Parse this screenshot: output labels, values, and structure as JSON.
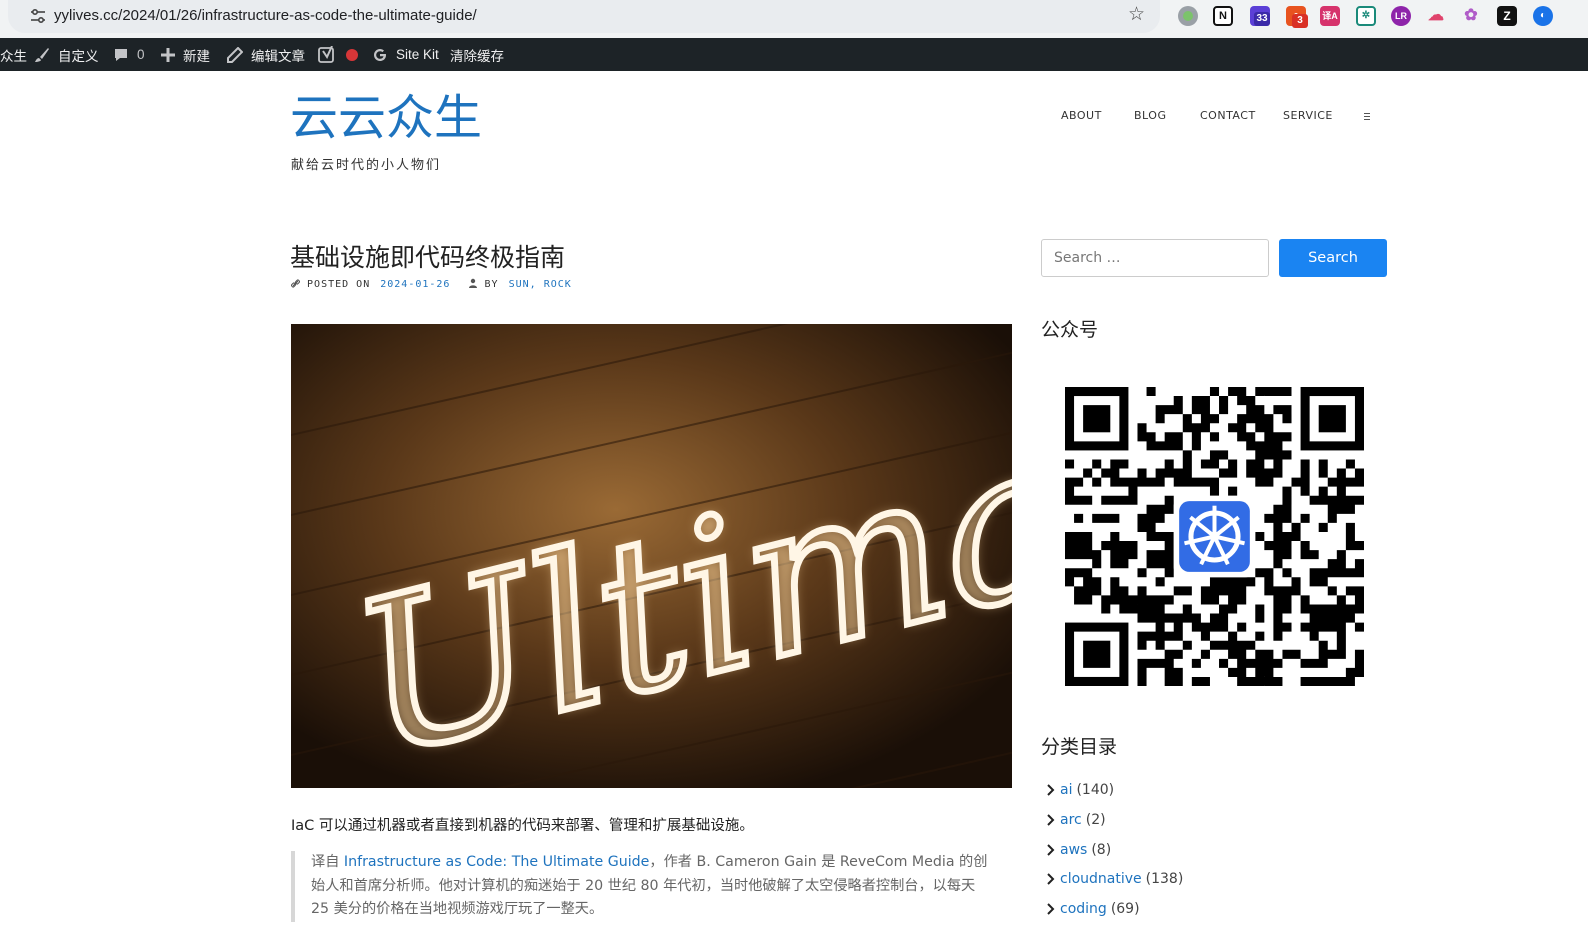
{
  "browser": {
    "url": "yylives.cc/2024/01/26/infrastructure-as-code-the-ultimate-guide/",
    "extensions": [
      {
        "icon": "green-circle-extension-icon"
      },
      {
        "icon": "notion-icon",
        "text": "N"
      },
      {
        "icon": "graduation-cap-extension-icon",
        "badge": "33"
      },
      {
        "icon": "office-extension-icon",
        "badge": "3"
      },
      {
        "icon": "translate-extension-icon",
        "text": "译A"
      },
      {
        "icon": "molecule-extension-icon"
      },
      {
        "icon": "lr-extension-icon",
        "text": "LR"
      },
      {
        "icon": "cloud-extension-icon"
      },
      {
        "icon": "openai-extension-icon"
      },
      {
        "icon": "zhihu-extension-icon"
      },
      {
        "icon": "blue-circle-extension-icon"
      }
    ]
  },
  "adminbar": {
    "site_fragment": "众生",
    "customize": "自定义",
    "comments_count": "0",
    "new": "新建",
    "edit_post": "编辑文章",
    "site_kit": "Site Kit",
    "clear_cache": "清除缓存"
  },
  "header": {
    "site_title": "云云众生",
    "site_description": "献给云时代的小人物们",
    "nav": [
      "ABOUT",
      "BLOG",
      "CONTACT",
      "SERVICE"
    ]
  },
  "article": {
    "title": "基础设施即代码终极指南",
    "meta": {
      "posted_on_label": "POSTED ON",
      "date": "2024-01-26",
      "by_label": "BY",
      "authors": "SUN, ROCK"
    },
    "hero_text": "Ultimate",
    "lead": "IaC 可以通过机器或者直接到机器的代码来部署、管理和扩展基础设施。",
    "quote": {
      "prefix": "译自",
      "link_text": "Infrastructure as Code: The Ultimate Guide",
      "rest": "，作者 B. Cameron Gain 是 ReveCom Media 的创始人和首席分析师。他对计算机的痴迷始于 20 世纪 80 年代初，当时他破解了太空侵略者控制台，以每天 25 美分的价格在当地视频游戏厅玩了一整天。"
    }
  },
  "sidebar": {
    "search": {
      "placeholder": "Search …",
      "button": "Search"
    },
    "wechat_title": "公众号",
    "categories_title": "分类目录",
    "categories": [
      {
        "name": "ai",
        "count": "(140)"
      },
      {
        "name": "arc",
        "count": "(2)"
      },
      {
        "name": "aws",
        "count": "(8)"
      },
      {
        "name": "cloudnative",
        "count": "(138)"
      },
      {
        "name": "coding",
        "count": "(69)"
      }
    ]
  },
  "colors": {
    "link": "#1e73be",
    "search_button": "#1a84f2",
    "adminbar": "#1d2327",
    "record_dot": "#d63638"
  }
}
